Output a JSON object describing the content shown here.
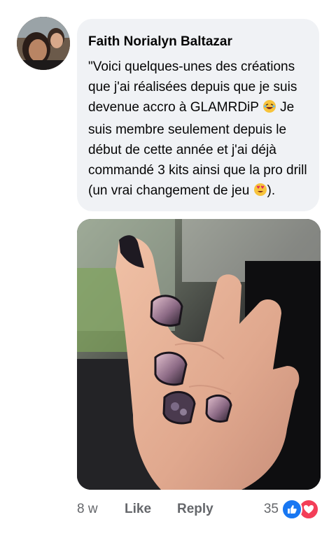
{
  "comment": {
    "author": "Faith Norialyn Baltazar",
    "text_part1": "\"Voici quelques-unes des créations que j'ai réalisées depuis que je suis devenue accro à GLAMRDiP",
    "text_part2": "Je suis membre seulement depuis le début de cette année et j'ai déjà commandé 3 kits ainsi que la pro drill (un vrai changement de jeu",
    "text_part3": ").",
    "emoji_1": "rolling-on-floor-laughing-emoji",
    "emoji_2": "heart-eyes-emoji"
  },
  "photo": {
    "subject": "hand-with-ombre-nails-photo"
  },
  "actions": {
    "time": "8 w",
    "like_label": "Like",
    "reply_label": "Reply",
    "reaction_count": "35",
    "reaction_icons": [
      "like-icon",
      "love-icon"
    ]
  },
  "colors": {
    "bubble_bg": "#f0f2f5",
    "meta_text": "#65676b",
    "like_blue": "#1877f2",
    "love_red": "#f33e58"
  }
}
